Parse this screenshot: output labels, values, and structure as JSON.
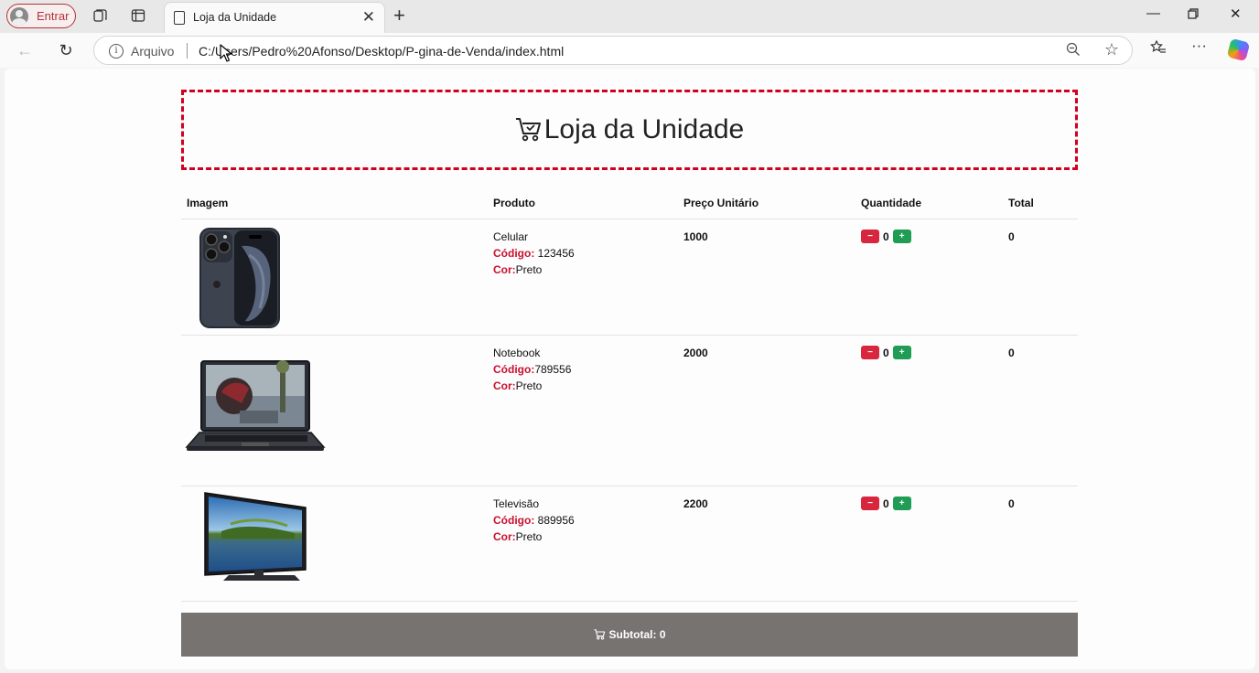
{
  "browser": {
    "profile_label": "Entrar",
    "tab_title": "Loja da Unidade",
    "address_scheme": "Arquivo",
    "address_url": "C:/Users/Pedro%20Afonso/Desktop/P-gina-de-Venda/index.html"
  },
  "page": {
    "title": "Loja da Unidade",
    "table": {
      "headers": [
        "Imagem",
        "Produto",
        "Preço Unitário",
        "Quantidade",
        "Total"
      ],
      "rows": [
        {
          "image": "smartphone",
          "name": "Celular",
          "code_label": "Código:",
          "code_value": " 123456",
          "color_label": "Cor:",
          "color_value": "Preto",
          "price": "1000",
          "qty": "0",
          "total": "0"
        },
        {
          "image": "laptop",
          "name": "Notebook",
          "code_label": "Código:",
          "code_value": "789556",
          "color_label": "Cor:",
          "color_value": "Preto",
          "price": "2000",
          "qty": "0",
          "total": "0"
        },
        {
          "image": "television",
          "name": "Televisão",
          "code_label": "Código:",
          "code_value": " 889956",
          "color_label": "Cor:",
          "color_value": "Preto",
          "price": "2200",
          "qty": "0",
          "total": "0"
        }
      ],
      "minus_symbol": "−",
      "plus_symbol": "+"
    },
    "subtotal_label": "Subtotal: 0"
  },
  "colors": {
    "hero_border": "#d1001f",
    "label_red": "#c8102e",
    "minus_button": "#d7263d",
    "plus_button": "#1f9d55",
    "subtotal_bar": "#777371"
  }
}
